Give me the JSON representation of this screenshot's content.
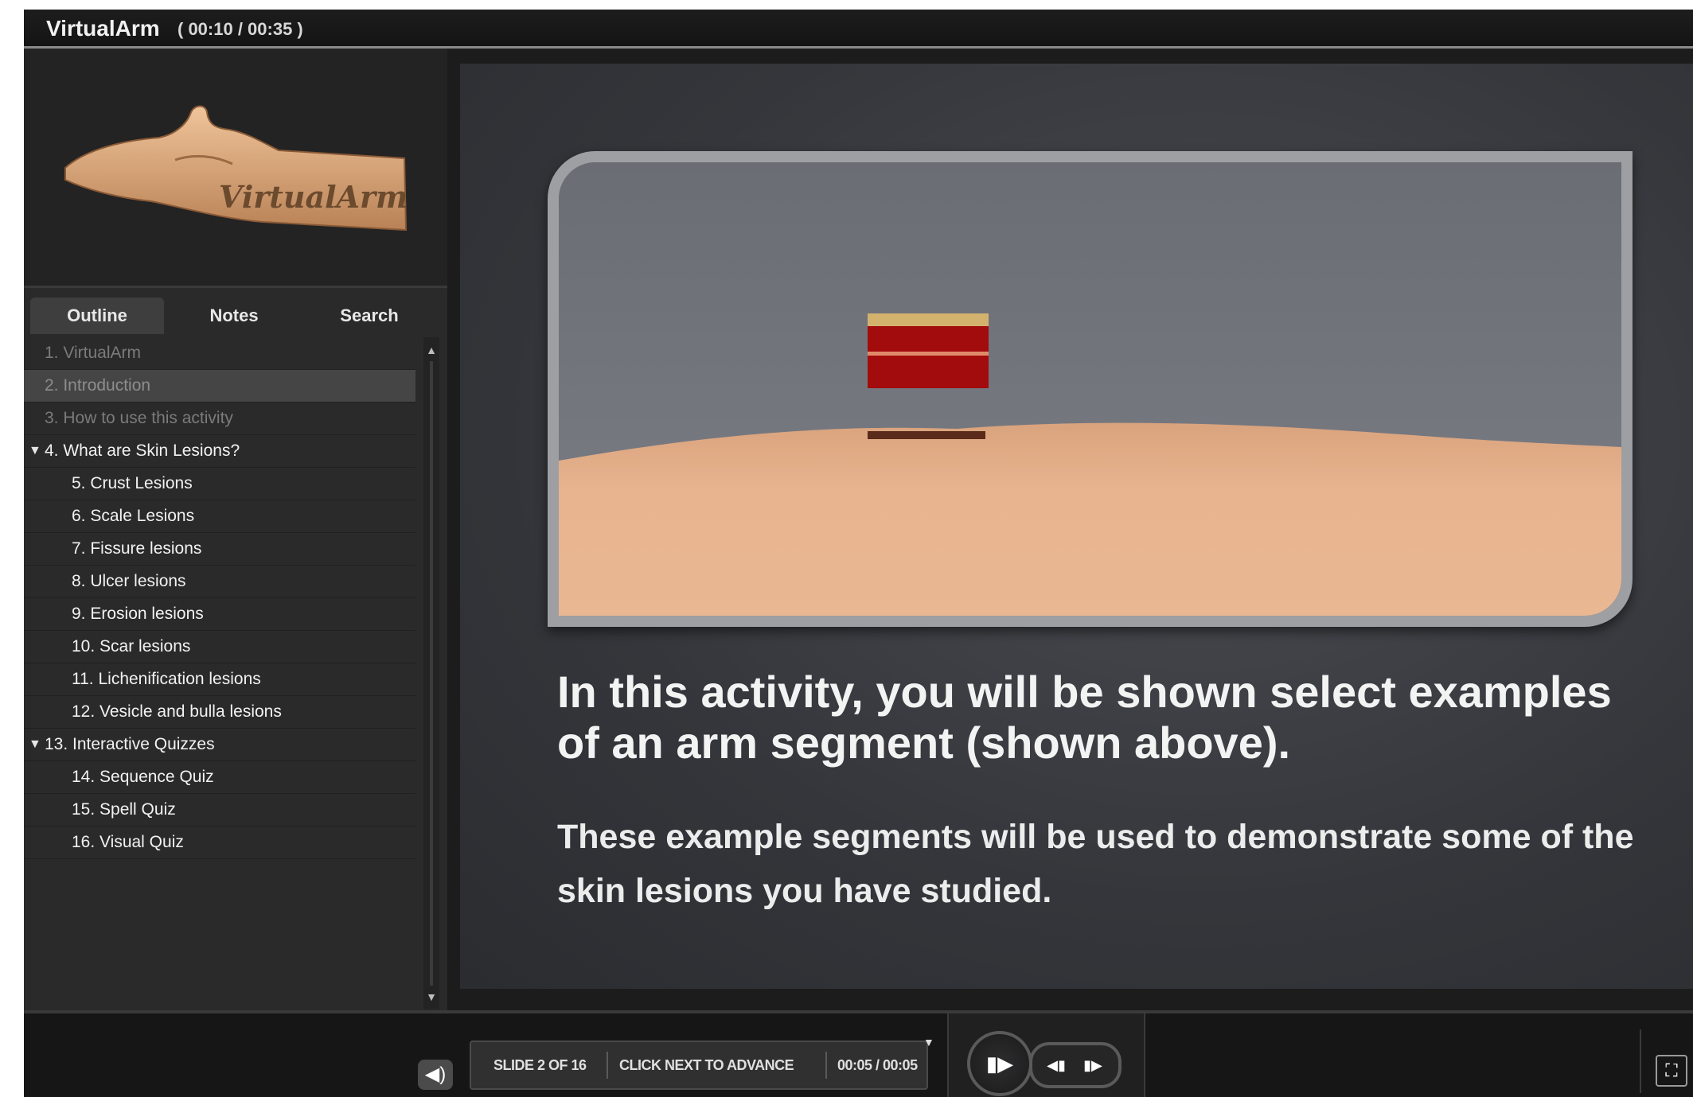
{
  "window": {
    "title": "VirtualArm",
    "time": "( 00:10 / 00:35 )"
  },
  "logo": {
    "text": "VirtualArm"
  },
  "tabs": [
    {
      "label": "Outline",
      "active": true
    },
    {
      "label": "Notes",
      "active": false
    },
    {
      "label": "Search",
      "active": false
    }
  ],
  "outline": [
    {
      "label": "1. VirtualArm",
      "level": 0,
      "state": "dim"
    },
    {
      "label": "2. Introduction",
      "level": 0,
      "state": "selected"
    },
    {
      "label": "3. How to use this activity",
      "level": 0,
      "state": "dim"
    },
    {
      "label": "4. What are Skin Lesions?",
      "level": 0,
      "state": "expanded"
    },
    {
      "label": "5. Crust Lesions",
      "level": 1,
      "state": "normal"
    },
    {
      "label": "6. Scale Lesions",
      "level": 1,
      "state": "normal"
    },
    {
      "label": "7. Fissure lesions",
      "level": 1,
      "state": "normal"
    },
    {
      "label": "8. Ulcer lesions",
      "level": 1,
      "state": "normal"
    },
    {
      "label": "9. Erosion lesions",
      "level": 1,
      "state": "normal"
    },
    {
      "label": "10. Scar lesions",
      "level": 1,
      "state": "normal"
    },
    {
      "label": "11. Lichenification lesions",
      "level": 1,
      "state": "normal"
    },
    {
      "label": "12. Vesicle and bulla lesions",
      "level": 1,
      "state": "normal"
    },
    {
      "label": "13. Interactive Quizzes",
      "level": 0,
      "state": "expanded"
    },
    {
      "label": "14. Sequence Quiz",
      "level": 1,
      "state": "normal"
    },
    {
      "label": "15. Spell Quiz",
      "level": 1,
      "state": "normal"
    },
    {
      "label": "16. Visual Quiz",
      "level": 1,
      "state": "normal"
    }
  ],
  "slide": {
    "heading": "In this activity, you will be shown select examples of an arm segment (shown above).",
    "body": "These  example segments will be used to demonstrate some of the skin lesions you have studied."
  },
  "player": {
    "slide_count": "SLIDE 2 OF 16",
    "hint": "CLICK NEXT TO ADVANCE",
    "slide_time": "00:05 / 00:05"
  },
  "icons": {
    "volume": "volume-icon",
    "play": "play-pause-icon",
    "prev": "previous-icon",
    "next": "next-icon",
    "fullscreen": "fullscreen-icon",
    "expand": "triangle-down-icon"
  },
  "colors": {
    "background": "#1c1c1d",
    "sidebar": "#2a2a2b",
    "skin": "#e7b48f",
    "lesion": "#a30c0c",
    "text": "#f3f3f3"
  }
}
